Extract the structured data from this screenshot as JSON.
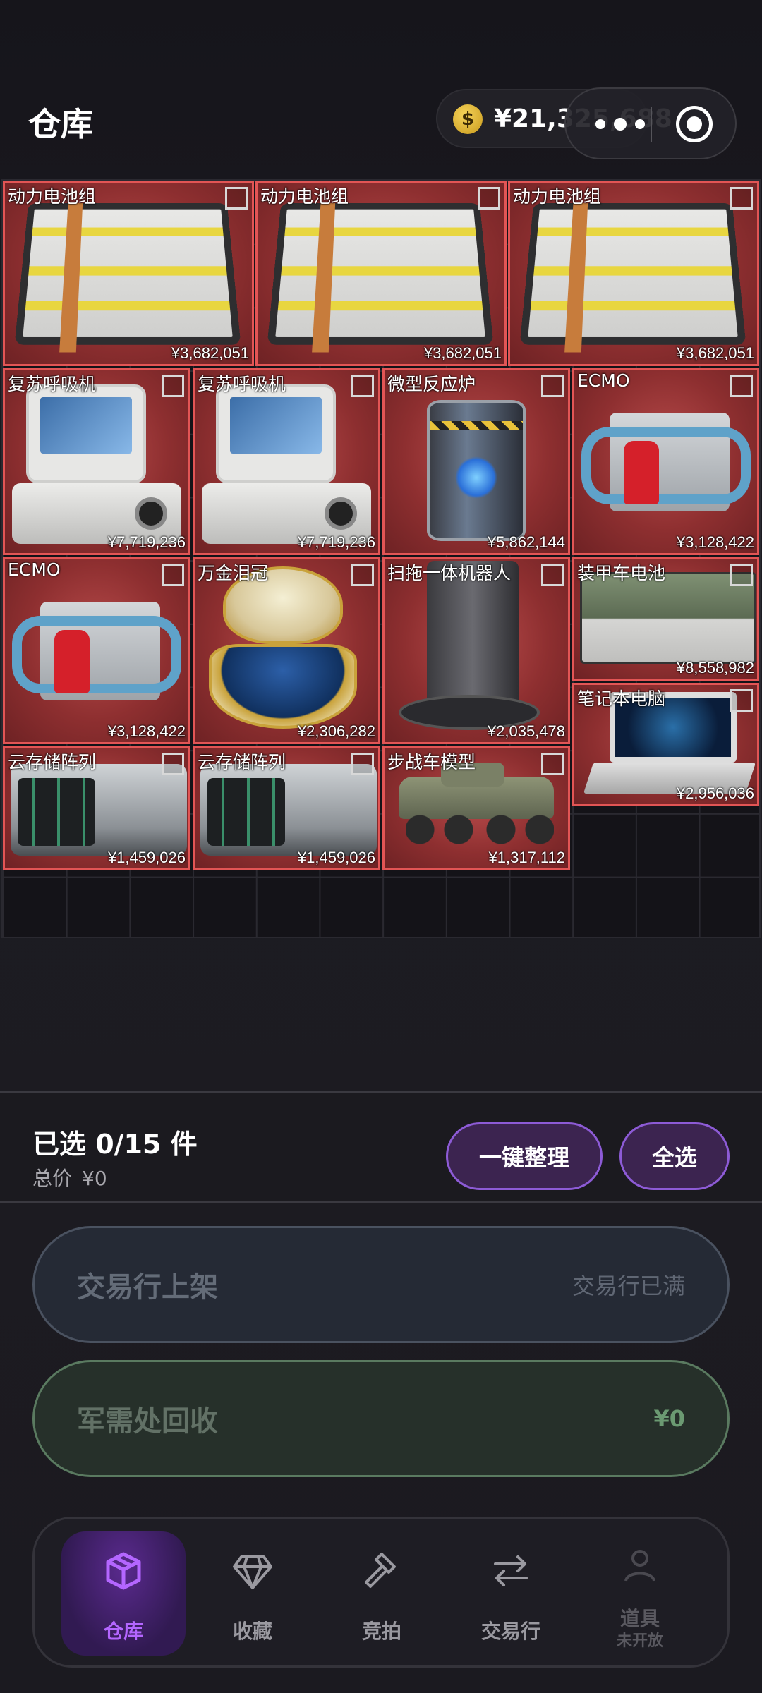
{
  "header": {
    "title": "仓库",
    "currency_symbol": "$",
    "currency_value": "¥21,325,688"
  },
  "items": [
    {
      "name": "动力电池组",
      "price": "¥3,682,051"
    },
    {
      "name": "动力电池组",
      "price": "¥3,682,051"
    },
    {
      "name": "动力电池组",
      "price": "¥3,682,051"
    },
    {
      "name": "复苏呼吸机",
      "price": "¥7,719,236"
    },
    {
      "name": "复苏呼吸机",
      "price": "¥7,719,236"
    },
    {
      "name": "微型反应炉",
      "price": "¥5,862,144"
    },
    {
      "name": "ECMO",
      "price": "¥3,128,422"
    },
    {
      "name": "ECMO",
      "price": "¥3,128,422"
    },
    {
      "name": "万金泪冠",
      "price": "¥2,306,282"
    },
    {
      "name": "扫拖一体机器人",
      "price": "¥2,035,478"
    },
    {
      "name": "装甲车电池",
      "price": "¥8,558,982"
    },
    {
      "name": "笔记本电脑",
      "price": "¥2,956,036"
    },
    {
      "name": "云存储阵列",
      "price": "¥1,459,026"
    },
    {
      "name": "云存储阵列",
      "price": "¥1,459,026"
    },
    {
      "name": "步战车模型",
      "price": "¥1,317,112"
    }
  ],
  "selection": {
    "count_text": "已选 0/15 件",
    "total_label": "总价",
    "total_value": "¥0",
    "organize_label": "一键整理",
    "select_all_label": "全选"
  },
  "actions": {
    "market_label": "交易行上架",
    "market_status": "交易行已满",
    "recycle_label": "军需处回收",
    "recycle_value": "¥0"
  },
  "nav": {
    "warehouse": "仓库",
    "collection": "收藏",
    "auction": "竞拍",
    "market": "交易行",
    "props": "道具",
    "props_sub": "未开放"
  },
  "colors": {
    "accent": "#b466ff",
    "item_border": "#e25555",
    "item_bg": "#8e2f30"
  }
}
